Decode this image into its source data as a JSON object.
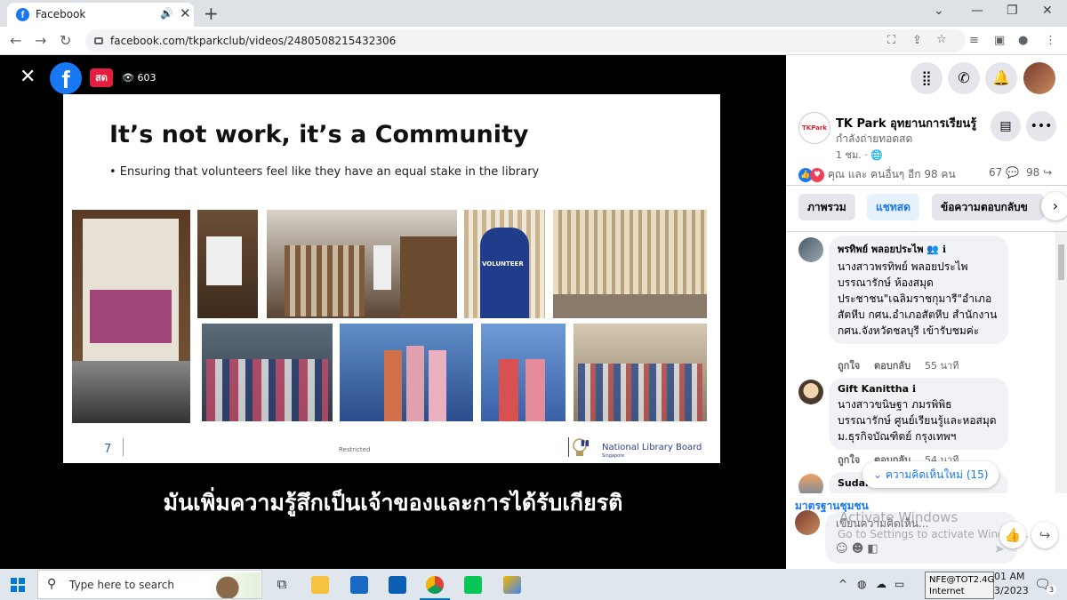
{
  "browser": {
    "tab_title": "Facebook",
    "tab_favicon": "f",
    "url": "facebook.com/tkparkclub/videos/2480508215432306"
  },
  "video": {
    "live_badge": "สด",
    "view_count": "603",
    "slide": {
      "title": "It’s not work, it’s a Community",
      "bullet": "•  Ensuring that volunteers feel like they have an equal stake in the library",
      "page_number": "7",
      "classification": "Restricted",
      "org_name": "National Library Board",
      "org_sub": "Singapore",
      "photo_volunteer_label": "VOLUNTEER"
    },
    "subtitle": "มันเพิ่มความรู้สึกเป็นเจ้าของและการได้รับเกียรติ"
  },
  "panel": {
    "page_name": "TK Park อุทยานการเรียนรู้",
    "page_logo_text": "TKPark",
    "status": "กำลังถ่ายทอดสด",
    "time_ago": "1 ชม. · 🌐",
    "reactions_text": "คุณ และ คนอื่นๆ อีก 98 คน",
    "comment_count": "67",
    "share_count": "98",
    "tabs": [
      "ภาพรวม",
      "แชทสด",
      "ข้อความตอบกลับข"
    ],
    "comments": [
      {
        "name": "พรทิพย์ พลอยประไพ",
        "text": "นางสาวพรทิพย์ พลอยประไพ บรรณารักษ์ ห้องสมุดประชาชน\"เฉลิมราชกุมารี\"อำเภอสัตหีบ กศน.อำเภอสัตหีบ สำนักงาน กศน.จังหวัดชลบุรี เข้ารับชมค่ะ",
        "like": "ถูกใจ",
        "reply": "ตอบกลับ",
        "time": "55 นาที"
      },
      {
        "name": "Gift Kanittha",
        "text": "นางสาวขนิษฐา ภมรพิพิธ บรรณารักษ์ ศูนย์เรียนรู้และหอสมุด ม.ธุรกิจบัณฑิตย์ กรุงเทพฯ",
        "like": "ถูกใจ",
        "reply": "ตอบกลับ",
        "time": "54 นาที"
      },
      {
        "name": "Sudarat Pakkanaa",
        "text": "",
        "like": "",
        "reply": "",
        "time": ""
      }
    ],
    "new_comments": "ความคิดเห็นใหม่ (15)",
    "community_standards": "มาตรฐานชุมชน",
    "composer_placeholder": "เขียนความคิดเห็น...",
    "watermark_title": "Activate Windows",
    "watermark_sub": "Go to Settings to activate Windows."
  },
  "taskbar": {
    "search_placeholder": "Type here to search",
    "clock_time": "01 AM",
    "clock_date": "3/2023",
    "tooltip_line1": "NFE@TOT2.4G",
    "tooltip_line2": "Internet access",
    "notification_count": "3"
  },
  "colors": {
    "facebook_blue": "#1877f2",
    "live_red": "#e41e3f"
  }
}
